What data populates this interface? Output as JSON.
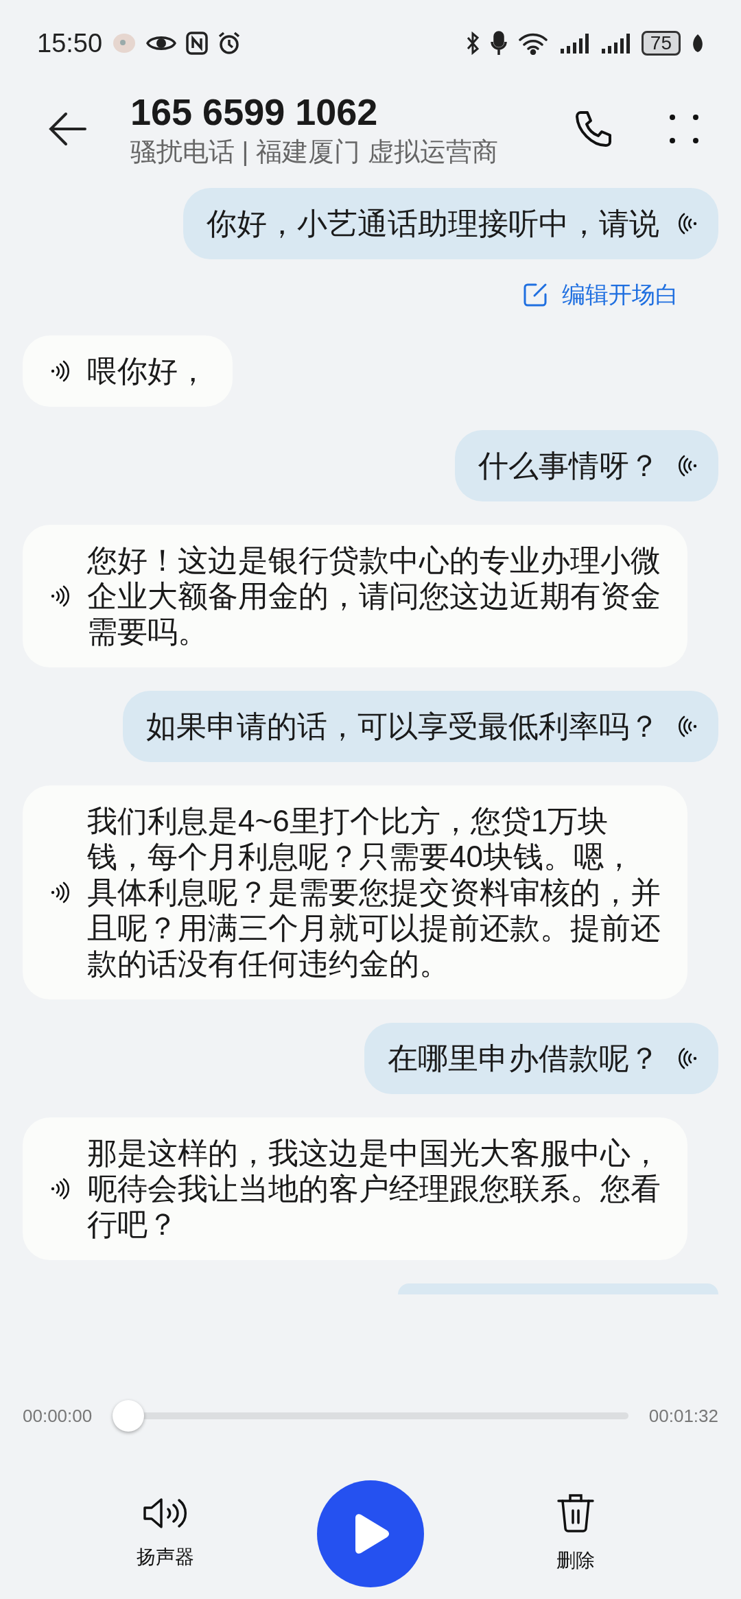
{
  "status_bar": {
    "time": "15:50",
    "battery": "75"
  },
  "header": {
    "number": "165 6599 1062",
    "subtitle": "骚扰电话 | 福建厦门 虚拟运营商"
  },
  "messages": [
    {
      "kind": "assistant",
      "text": "你好，小艺通话助理接听中，请说"
    },
    {
      "kind": "action",
      "text": "编辑开场白"
    },
    {
      "kind": "caller",
      "text": "喂你好，"
    },
    {
      "kind": "assistant",
      "text": "什么事情呀？"
    },
    {
      "kind": "caller",
      "text": "您好！这边是银行贷款中心的专业办理小微企业大额备用金的，请问您这边近期有资金需要吗。"
    },
    {
      "kind": "assistant",
      "text": "如果申请的话，可以享受最低利率吗？"
    },
    {
      "kind": "caller",
      "text": "我们利息是4~6里打个比方，您贷1万块钱，每个月利息呢？只需要40块钱。嗯，具体利息呢？是需要您提交资料审核的，并且呢？用满三个月就可以提前还款。提前还款的话没有任何违约金的。"
    },
    {
      "kind": "assistant",
      "text": "在哪里申办借款呢？"
    },
    {
      "kind": "caller",
      "text": "那是这样的，我这边是中国光大客服中心，呃待会我让当地的客户经理跟您联系。您看行吧？"
    },
    {
      "kind": "cut_off"
    }
  ],
  "player": {
    "elapsed": "00:00:00",
    "total": "00:01:32",
    "level": 0
  },
  "controls": [
    {
      "kind": "speaker",
      "label": "扬声器"
    },
    {
      "kind": "play"
    },
    {
      "kind": "delete",
      "label": "删除"
    }
  ]
}
